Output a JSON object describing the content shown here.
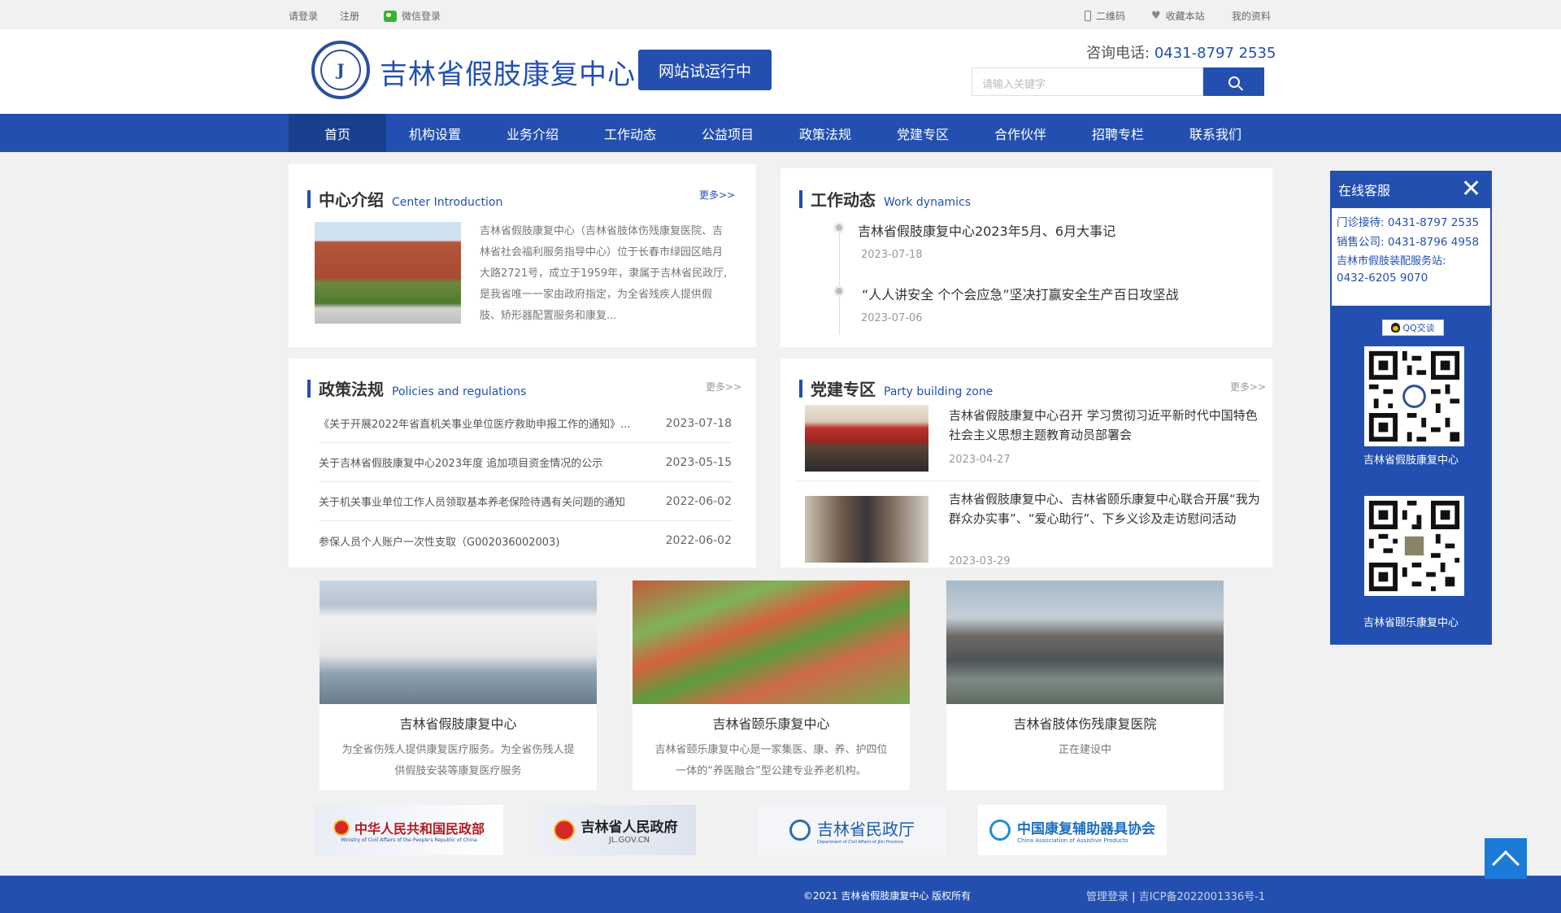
{
  "topbar": {
    "login": "请登录",
    "register": "注册",
    "wechat_login": "微信登录",
    "qrcode": "二维码",
    "bookmark": "收藏本站",
    "my_profile": "我的资料"
  },
  "header": {
    "site_name": "吉林省假肢康复中心",
    "trial_badge": "网站试运行中",
    "hotline_label": "咨询电话:",
    "hotline_number": "0431-8797 2535",
    "search_placeholder": "请输入关键字",
    "brand_color": "#2350b0"
  },
  "nav": {
    "items": [
      "首页",
      "机构设置",
      "业务介绍",
      "工作动态",
      "公益项目",
      "政策法规",
      "党建专区",
      "合作伙伴",
      "招聘专栏",
      "联系我们"
    ],
    "active": "首页"
  },
  "intro": {
    "title": "中心介绍",
    "title_en": "Center Introduction",
    "more": "更多>>",
    "text": "吉林省假肢康复中心（吉林省肢体伤残康复医院、吉林省社会福利服务指导中心）位于长春市绿园区皓月大路2721号，成立于1959年，隶属于吉林省民政厅,是我省唯一一家由政府指定，为全省残疾人提供假肢、矫形器配置服务和康复..."
  },
  "work": {
    "title": "工作动态",
    "title_en": "Work dynamics",
    "items": [
      {
        "title": "吉林省假肢康复中心2023年5月、6月大事记",
        "date": "2023-07-18"
      },
      {
        "title": "“人人讲安全 个个会应急”坚决打赢安全生产百日攻坚战",
        "date": "2023-07-06"
      }
    ]
  },
  "policy": {
    "title": "政策法规",
    "title_en": "Policies and regulations",
    "more": "更多>>",
    "items": [
      {
        "title": "《关于开展2022年省直机关事业单位医疗救助申报工作的通知》...",
        "date": "2023-07-18"
      },
      {
        "title": "关于吉林省假肢康复中心2023年度 追加项目资金情况的公示",
        "date": "2023-05-15"
      },
      {
        "title": "关于机关事业单位工作人员领取基本养老保险待遇有关问题的通知",
        "date": "2022-06-02"
      },
      {
        "title": "参保人员个人账户一次性支取（G002036002003)",
        "date": "2022-06-02"
      }
    ]
  },
  "party": {
    "title": "党建专区",
    "title_en": "Party building zone",
    "more": "更多>>",
    "items": [
      {
        "title": "吉林省假肢康复中心召开 学习贯彻习近平新时代中国特色社会主义思想主题教育动员部署会",
        "date": "2023-04-27"
      },
      {
        "title": "吉林省假肢康复中心、吉林省颐乐康复中心联合开展“我为群众办实事”、“爱心助行”、下乡义诊及走访慰问活动",
        "date": "2023-03-29"
      }
    ]
  },
  "cards": [
    {
      "title": "吉林省假肢康复中心",
      "desc": "为全省伤残人提供康复医疗服务。为全省伤残人提供假肢安装等康复医疗服务"
    },
    {
      "title": "吉林省颐乐康复中心",
      "desc": "吉林省颐乐康复中心是一家集医、康、养、护四位一体的“养医融合”型公建专业养老机构。"
    },
    {
      "title": "吉林省肢体伤残康复医院",
      "desc": "正在建设中"
    }
  ],
  "partners": {
    "mca_cn": "中华人民共和国民政部",
    "mca_en": "Ministry of Civil Affairs of the People's Republic of China",
    "jilin_gov": "吉林省人民政府",
    "jilin_gov_url": "JL.GOV.CN",
    "jilin_civil": "吉林省民政厅",
    "jilin_civil_en": "Department of Civil Affairs of Jilin Province",
    "caat_cn": "中国康复辅助器具协会",
    "caat_en": "China Association of Assistive Products"
  },
  "footer": {
    "copyright": "©2021 吉林省假肢康复中心 版权所有",
    "admin_login": "管理登录",
    "separator": "|",
    "icp": "吉ICP备2022001336号-1"
  },
  "service": {
    "title": "在线客服",
    "clinic_label": "门诊接待:",
    "clinic_phone": "0431-8797 2535",
    "sales_label": "销售公司:",
    "sales_phone": "0431-8796 4958",
    "station_label": "吉林市假肢装配服务站:",
    "station_phone": "0432-6205 9070",
    "qq_label": "QQ交谈",
    "qr1_label": "吉林省假肢康复中心",
    "qr2_label": "吉林省颐乐康复中心"
  }
}
